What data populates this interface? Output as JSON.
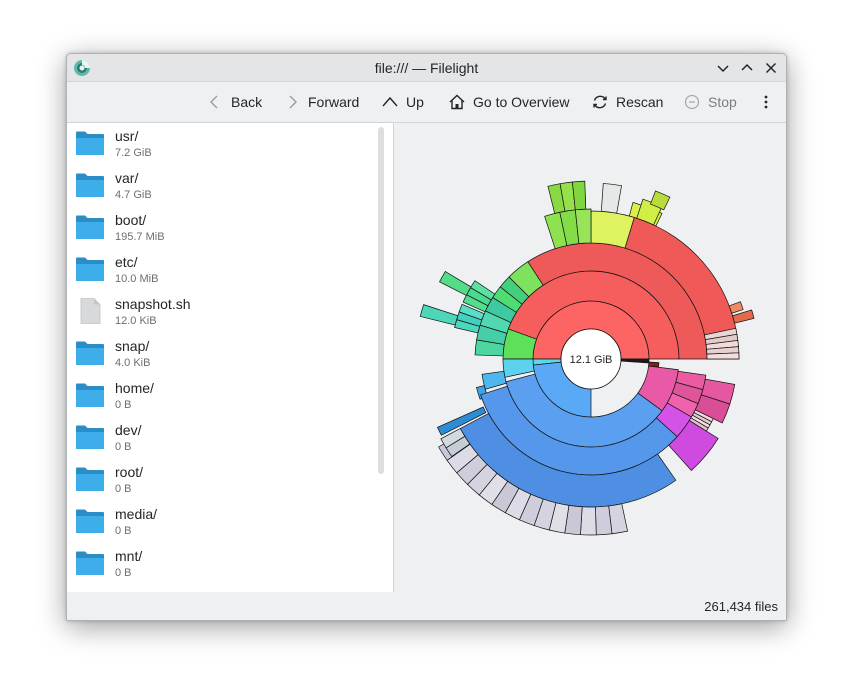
{
  "window": {
    "title": "file:/// — Filelight"
  },
  "titlebar_buttons": [
    "minimize",
    "maximize",
    "close"
  ],
  "toolbar": {
    "back": "Back",
    "forward": "Forward",
    "up": "Up",
    "overview": "Go to Overview",
    "rescan": "Rescan",
    "stop": "Stop"
  },
  "files": [
    {
      "name": "usr/",
      "size": "7.2 GiB",
      "type": "folder"
    },
    {
      "name": "var/",
      "size": "4.7 GiB",
      "type": "folder"
    },
    {
      "name": "boot/",
      "size": "195.7 MiB",
      "type": "folder"
    },
    {
      "name": "etc/",
      "size": "10.0 MiB",
      "type": "folder"
    },
    {
      "name": "snapshot.sh",
      "size": "12.0 KiB",
      "type": "file"
    },
    {
      "name": "snap/",
      "size": "4.0 KiB",
      "type": "folder"
    },
    {
      "name": "home/",
      "size": "0 B",
      "type": "folder"
    },
    {
      "name": "dev/",
      "size": "0 B",
      "type": "folder"
    },
    {
      "name": "root/",
      "size": "0 B",
      "type": "folder"
    },
    {
      "name": "media/",
      "size": "0 B",
      "type": "folder"
    },
    {
      "name": "mnt/",
      "size": "0 B",
      "type": "folder"
    }
  ],
  "chart": {
    "center_label": "12.1 GiB"
  },
  "status": {
    "files": "261,434 files"
  },
  "colors": {
    "folder": "#3daee9",
    "usr_ring": "#f25c5c",
    "var_ring": "#5b9ff0",
    "green": "#5fe05a",
    "magenta": "#e0559a",
    "violet": "#d452e6"
  }
}
